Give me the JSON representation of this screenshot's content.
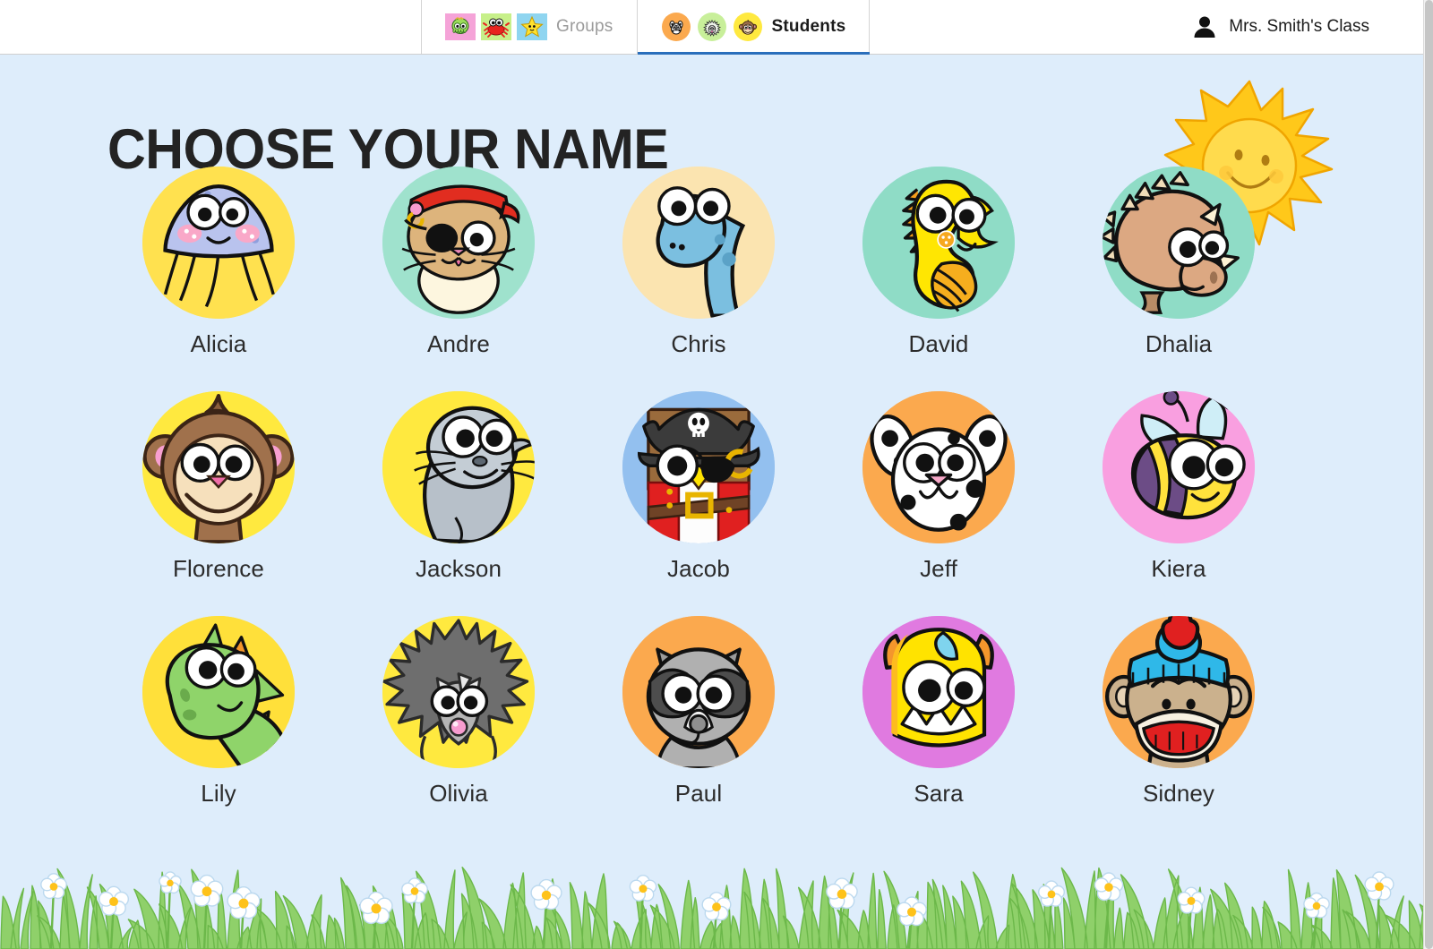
{
  "app": {
    "background_color": "#deedfb",
    "accent_color": "#2a6ebb"
  },
  "topbar": {
    "tabs": [
      {
        "id": "groups",
        "label": "Groups",
        "active": false,
        "icons": [
          "octopus-tile-icon",
          "crab-tile-icon",
          "star-tile-icon"
        ]
      },
      {
        "id": "students",
        "label": "Students",
        "active": true,
        "icons": [
          "dalmatian-chip-icon",
          "hedgehog-chip-icon",
          "monkey-chip-icon"
        ]
      }
    ],
    "user": {
      "name": "Mrs. Smith's Class",
      "icon": "person-icon"
    }
  },
  "main": {
    "title": "CHOOSE YOUR NAME",
    "decorations": [
      "sun-icon",
      "grass-border",
      "flower-icons"
    ]
  },
  "students": [
    {
      "name": "Alicia",
      "avatar": "jellyfish",
      "bg": "#ffe14f"
    },
    {
      "name": "Andre",
      "avatar": "pirate-cat",
      "bg": "#9fe2cd"
    },
    {
      "name": "Chris",
      "avatar": "dinosaur",
      "bg": "#fbe4b0"
    },
    {
      "name": "David",
      "avatar": "seahorse",
      "bg": "#8fdcc6"
    },
    {
      "name": "Dhalia",
      "avatar": "triceratops",
      "bg": "#8fdcc6"
    },
    {
      "name": "Florence",
      "avatar": "monkey",
      "bg": "#ffe93f"
    },
    {
      "name": "Jackson",
      "avatar": "seal",
      "bg": "#ffe93f"
    },
    {
      "name": "Jacob",
      "avatar": "pirate-bear",
      "bg": "#93c0ef"
    },
    {
      "name": "Jeff",
      "avatar": "dalmatian",
      "bg": "#fba94e"
    },
    {
      "name": "Kiera",
      "avatar": "bee",
      "bg": "#f99fe0"
    },
    {
      "name": "Lily",
      "avatar": "dragon",
      "bg": "#ffe03a"
    },
    {
      "name": "Olivia",
      "avatar": "hedgehog",
      "bg": "#ffe93f"
    },
    {
      "name": "Paul",
      "avatar": "raccoon",
      "bg": "#fba94e"
    },
    {
      "name": "Sara",
      "avatar": "monster",
      "bg": "#e07ae0"
    },
    {
      "name": "Sidney",
      "avatar": "sock-monkey",
      "bg": "#fba94e"
    }
  ]
}
